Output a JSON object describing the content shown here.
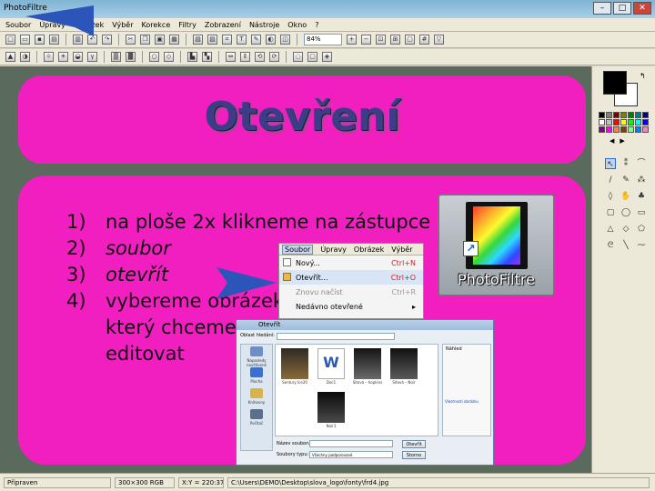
{
  "window": {
    "title": "PhotoFiltre",
    "buttons": {
      "minimize": "–",
      "maximize": "□",
      "close": "✕"
    }
  },
  "menubar": [
    "Soubor",
    "Úpravy",
    "Obrázek",
    "Výběr",
    "Korekce",
    "Filtry",
    "Zobrazení",
    "Nástroje",
    "Okno",
    "?"
  ],
  "toolbar": {
    "zoom": "84%"
  },
  "slide": {
    "title": "Otevření",
    "steps": [
      {
        "num": "1)",
        "text": "na ploše 2x klikneme na zástupce"
      },
      {
        "num": "2)",
        "text": "soubor"
      },
      {
        "num": "3)",
        "text": "otevřít"
      },
      {
        "num": "4)",
        "text": "vybereme obrázek,",
        "cont1": "který chceme",
        "cont2": "editovat"
      }
    ]
  },
  "shortcut": {
    "label": "PhotoFiltre"
  },
  "file_menu": {
    "bar": [
      "Soubor",
      "Úpravy",
      "Obrázek",
      "Výběr"
    ],
    "items": [
      {
        "label": "Nový...",
        "shortcut": "Ctrl+N"
      },
      {
        "label": "Otevřít...",
        "shortcut": "Ctrl+O"
      },
      {
        "label": "Znovu načíst",
        "shortcut": "Ctrl+R"
      },
      {
        "label": "Nedávno otevřené",
        "shortcut": "▸"
      }
    ]
  },
  "open_dialog": {
    "title": "Otevřít",
    "look_in_label": "Oblast hledání:",
    "places": [
      "Naposledy navštívené",
      "Plocha",
      "Knihovny",
      "Počítač"
    ],
    "files": [
      "Sentury Ice20",
      "Doc1",
      "Sitová – hopkins",
      "Sitová – Noir",
      "Noir1",
      "Noir2"
    ],
    "preview_label": "Náhled",
    "preview_info": "Vlastnosti obrázku",
    "filename_label": "Název souboru:",
    "filetype_label": "Soubory typu:",
    "filetype_value": "Všechny podporované",
    "open_button": "Otevřít",
    "cancel_button": "Storno"
  },
  "statusbar": {
    "state": "Připraven",
    "size": "300×300 RGB",
    "coords": "X:Y = 220:371",
    "path": "C:\\Users\\DEMO\\Desktop\\slova_logo\\fonty\\frd4.jpg"
  },
  "colors": {
    "panel_pink": "#f11fbf",
    "title_text": "#3b3d86",
    "annotation_arrow": "#2b55b8"
  }
}
